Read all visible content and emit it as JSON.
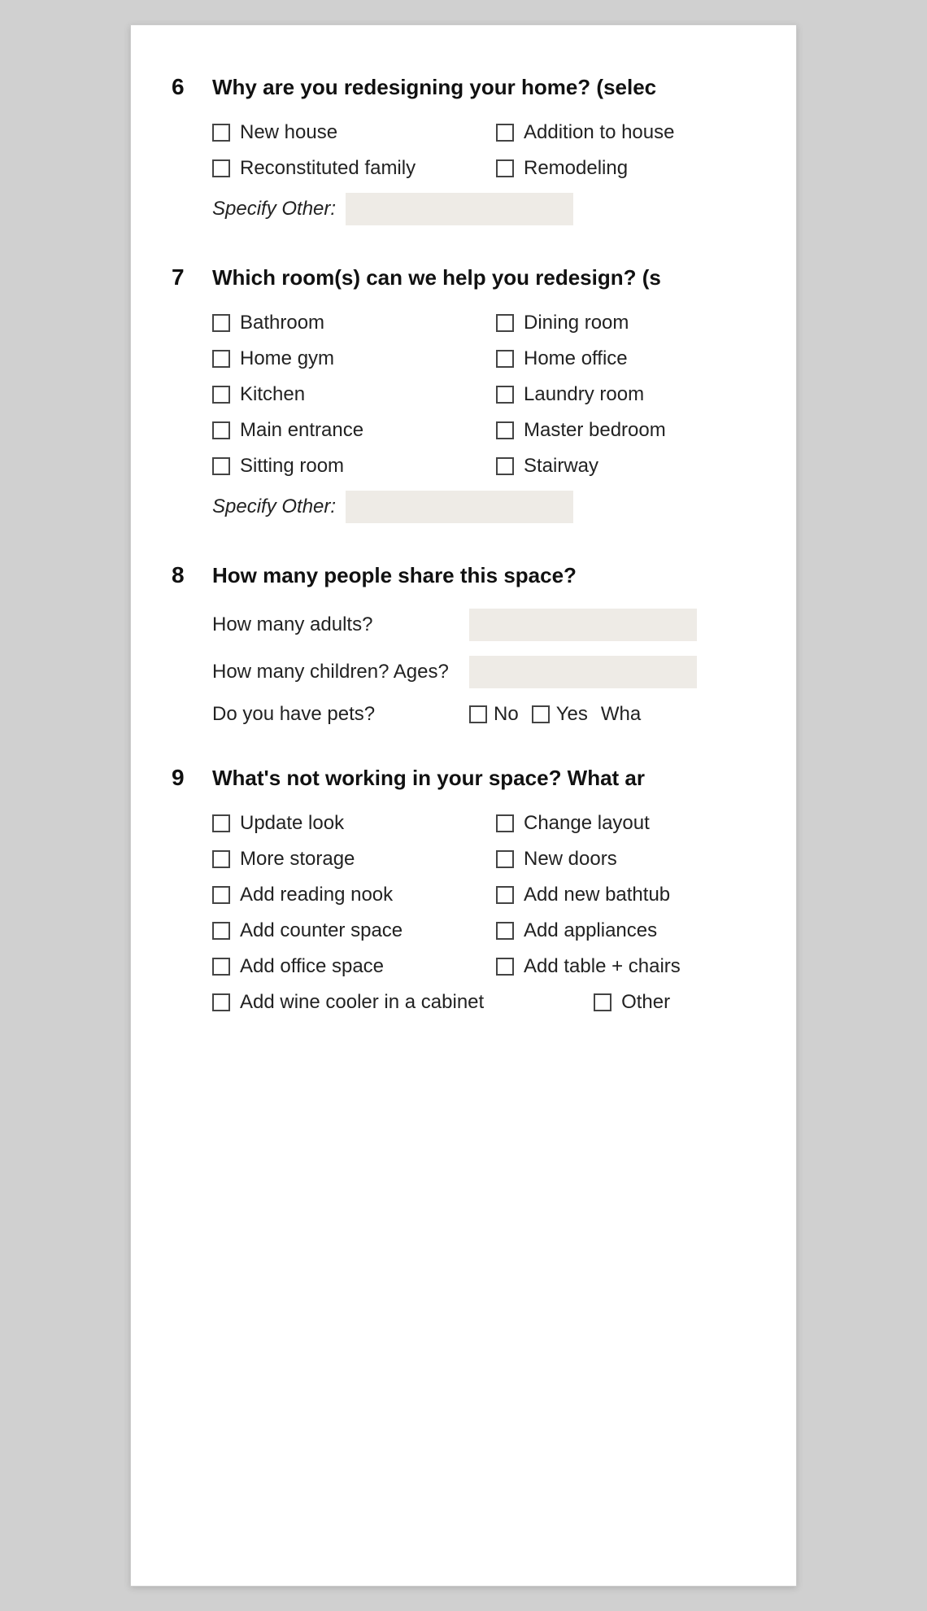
{
  "questions": [
    {
      "number": "6",
      "text": "Why are you redesigning your home? (selec",
      "options": [
        {
          "label": "New house",
          "col": 0
        },
        {
          "label": "Addition to house",
          "col": 1
        },
        {
          "label": "Reconstituted family",
          "col": 0
        },
        {
          "label": "Remodeling",
          "col": 1
        }
      ],
      "specify_label": "Specify Other:"
    },
    {
      "number": "7",
      "text": "Which room(s) can we help you redesign? (s",
      "options": [
        {
          "label": "Bathroom",
          "col": 0
        },
        {
          "label": "Dining room",
          "col": 1
        },
        {
          "label": "Home gym",
          "col": 0
        },
        {
          "label": "Home office",
          "col": 1
        },
        {
          "label": "Kitchen",
          "col": 0
        },
        {
          "label": "Laundry room",
          "col": 1
        },
        {
          "label": "Main entrance",
          "col": 0
        },
        {
          "label": "Master bedroom",
          "col": 1
        },
        {
          "label": "Sitting room",
          "col": 0
        },
        {
          "label": "Stairway",
          "col": 1
        }
      ],
      "specify_label": "Specify Other:"
    },
    {
      "number": "8",
      "text": "How many people share this space?",
      "adults_label": "How many adults?",
      "children_label": "How many children? Ages?",
      "pets_label": "Do you have pets?",
      "pets_no": "No",
      "pets_yes": "Yes",
      "pets_what": "Wha"
    },
    {
      "number": "9",
      "text": "What's not working in your space? What ar",
      "options": [
        {
          "label": "Update look",
          "col": 0
        },
        {
          "label": "Change layout",
          "col": 1
        },
        {
          "label": "More storage",
          "col": 0
        },
        {
          "label": "New doors",
          "col": 1
        },
        {
          "label": "Add reading nook",
          "col": 0
        },
        {
          "label": "Add new bathtub",
          "col": 1
        },
        {
          "label": "Add counter space",
          "col": 0
        },
        {
          "label": "Add appliances",
          "col": 1
        },
        {
          "label": "Add office space",
          "col": 0
        },
        {
          "label": "Add table + chairs",
          "col": 1
        },
        {
          "label": "Add wine cooler in a cabinet",
          "col": 0
        },
        {
          "label": "Other",
          "col": 1
        }
      ]
    }
  ]
}
